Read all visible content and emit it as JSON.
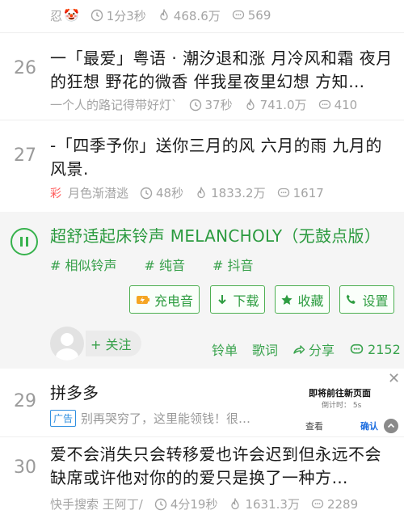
{
  "top_item": {
    "author": "忍",
    "duration": "1分3秒",
    "plays": "468.6万",
    "comments": "569"
  },
  "songs": [
    {
      "rank": "26",
      "title": "一「最爱」粤语 · 潮汐退和涨 月冷风和霜 夜月的狂想 野花的微香 伴我星夜里幻想 方知…",
      "author": "一个人的路记得带好灯`",
      "duration": "37秒",
      "plays": "741.0万",
      "comments": "410"
    },
    {
      "rank": "27",
      "title": "-「四季予你」送你三月的风 六月的雨 九月的风景.",
      "author_badge": "彩",
      "author": "月色渐潜逃",
      "duration": "48秒",
      "plays": "1833.2万",
      "comments": "1617"
    },
    {
      "rank": "30",
      "title": "爱不会消失只会转移爱也许会迟到但永远不会缺席或许他对你的的爱只是换了一种方…",
      "author": "快手搜索 王阿丁/",
      "duration": "4分19秒",
      "plays": "1631.3万",
      "comments": "2289"
    }
  ],
  "now_playing": {
    "title": "超舒适起床铃声 MELANCHOLY（无鼓点版）",
    "tags": [
      "# 相似铃声",
      "# 纯音",
      "# 抖音"
    ],
    "actions": [
      "充电音",
      "下载",
      "收藏",
      "设置"
    ],
    "follow": "+ 关注",
    "links": [
      "铃单",
      "歌词",
      "分享"
    ],
    "comments": "2152"
  },
  "ad": {
    "rank": "29",
    "title": "拼多多",
    "badge": "广告",
    "text": "别再哭穷了，这里能领钱！很…",
    "popup_title": "即将前往新页面",
    "popup_countdown": "倒计时：  5s",
    "popup_look": "查看",
    "popup_confirm": "确认",
    "close": "✕"
  },
  "colors": {
    "accent_green": "#37b24d",
    "meta_gray": "#a4a4a4",
    "ad_blue": "#2f8fe0"
  }
}
